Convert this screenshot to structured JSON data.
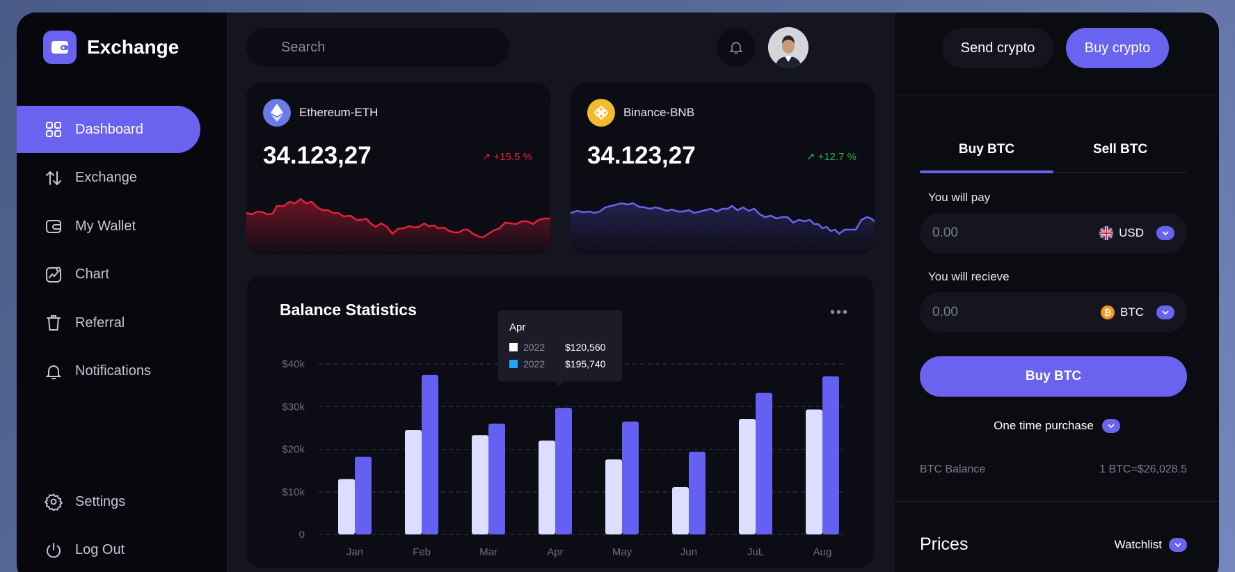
{
  "brand": {
    "name": "Exchange"
  },
  "nav": {
    "items": [
      {
        "label": "Dashboard",
        "icon": "dashboard-icon",
        "active": true
      },
      {
        "label": "Exchange",
        "icon": "exchange-arrows-icon"
      },
      {
        "label": "My Wallet",
        "icon": "wallet-icon"
      },
      {
        "label": "Chart",
        "icon": "chart-icon"
      },
      {
        "label": "Referral",
        "icon": "trash-icon"
      },
      {
        "label": "Notifications",
        "icon": "bell-icon"
      }
    ],
    "bottom": [
      {
        "label": "Settings",
        "icon": "gear-icon"
      },
      {
        "label": "Log Out",
        "icon": "power-icon"
      }
    ]
  },
  "header": {
    "search_placeholder": "Search"
  },
  "cards": [
    {
      "name": "Ethereum-ETH",
      "value": "34.123,27",
      "change": "+15.5 %",
      "change_color": "#e5213c",
      "icon_color": "#6a7be8"
    },
    {
      "name": "Binance-BNB",
      "value": "34.123,27",
      "change": "+12.7 %",
      "change_color": "#21b54a",
      "icon_color": "#f3ba2f"
    }
  ],
  "stats": {
    "title": "Balance Statistics",
    "tooltip": {
      "month": "Apr",
      "rows": [
        {
          "year": "2022",
          "value": "$120,560",
          "color": "#ffffff"
        },
        {
          "year": "2022",
          "value": "$195,740",
          "color": "#1ea7ff"
        }
      ]
    }
  },
  "chart_data": {
    "type": "bar",
    "categories": [
      "Jan",
      "Feb",
      "Mar",
      "Apr",
      "May",
      "Jun",
      "JuL",
      "Aug"
    ],
    "series": [
      {
        "values": [
          13000,
          24500,
          23300,
          22000,
          17600,
          11100,
          27100,
          29300
        ],
        "color": "#ddddff"
      },
      {
        "values": [
          18200,
          37400,
          26000,
          29700,
          26500,
          19400,
          33200,
          37100
        ],
        "color": "#6360f2"
      }
    ],
    "yticks": [
      "0",
      "$10k",
      "$20k",
      "$30k",
      "$40k"
    ],
    "ylim": [
      0,
      40000
    ],
    "grid": true
  },
  "right": {
    "send_label": "Send crypto",
    "buy_label": "Buy crypto",
    "tabs": [
      "Buy BTC",
      "Sell BTC"
    ],
    "pay_label": "You will pay",
    "pay_value": "0.00",
    "pay_currency": "USD",
    "receive_label": "You will recieve",
    "receive_value": "0.00",
    "receive_currency": "BTC",
    "buy_button": "Buy BTC",
    "purchase_type": "One time purchase",
    "balance_label": "BTC Balance",
    "balance_rate": "1 BTC=$26,028.5",
    "prices_title": "Prices",
    "watchlist_label": "Watchlist"
  }
}
